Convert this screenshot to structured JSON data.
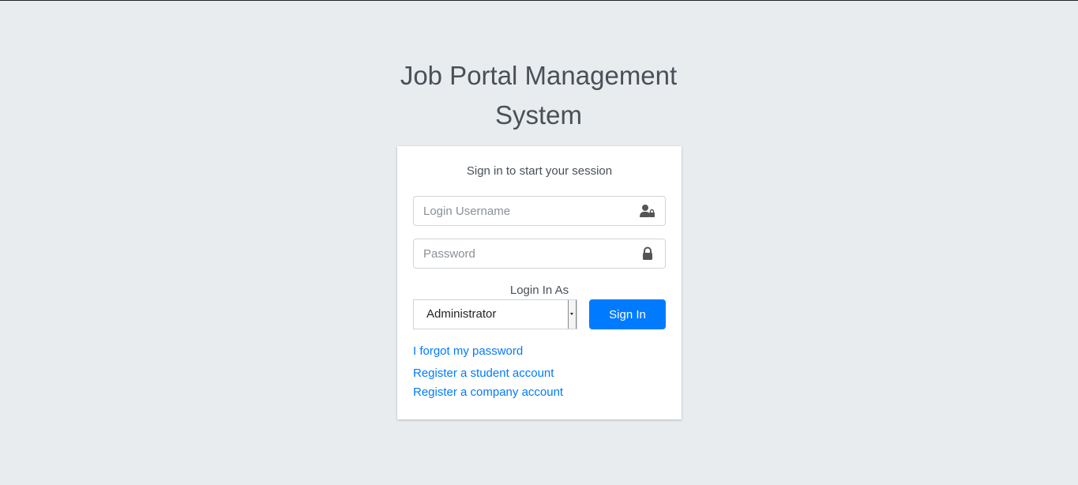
{
  "title": "Job Portal Management System",
  "card": {
    "message": "Sign in to start your session",
    "username": {
      "placeholder": "Login Username",
      "value": "",
      "icon": "user-lock-icon"
    },
    "password": {
      "placeholder": "Password",
      "value": "",
      "icon": "lock-icon"
    },
    "login_as_label": "Login In As",
    "role_select": {
      "selected": "Administrator"
    },
    "sign_in_label": "Sign In",
    "links": {
      "forgot": "I forgot my password",
      "register_student": "Register a student account",
      "register_company": "Register a company account"
    }
  },
  "colors": {
    "background": "#e9ecef",
    "primary": "#007bff",
    "card": "#ffffff",
    "text": "#495057"
  }
}
